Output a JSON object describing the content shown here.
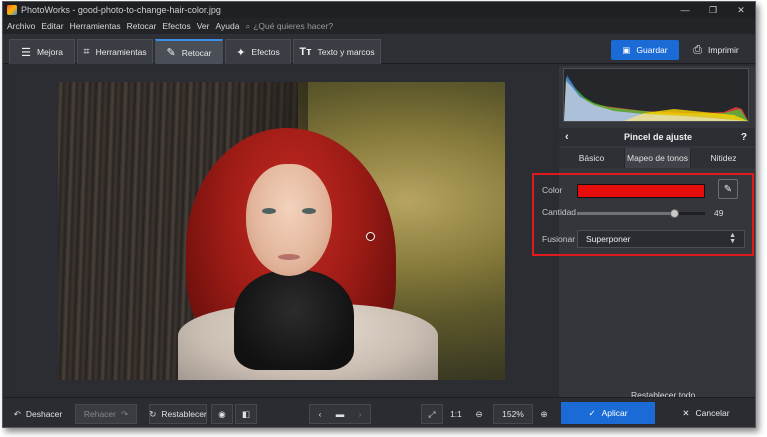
{
  "window": {
    "title": "PhotoWorks - good-photo-to-change-hair-color.jpg",
    "controls": [
      "—",
      "❐",
      "✕"
    ]
  },
  "menu": {
    "items": [
      "Archivo",
      "Editar",
      "Herramientas",
      "Retocar",
      "Efectos",
      "Ver",
      "Ayuda"
    ],
    "search_placeholder": "¿Qué quieres hacer?"
  },
  "tabs": [
    {
      "label": "Mejora",
      "icon": "sliders-icon"
    },
    {
      "label": "Herramientas",
      "icon": "crop-icon"
    },
    {
      "label": "Retocar",
      "icon": "brush-icon"
    },
    {
      "label": "Efectos",
      "icon": "wand-icon"
    },
    {
      "label": "Texto y marcos",
      "icon": "text-icon"
    }
  ],
  "actions": {
    "save": "Guardar",
    "print": "Imprimir"
  },
  "panel": {
    "title": "Pincel de ajuste",
    "subtabs": [
      "Básico",
      "Mapeo de tonos",
      "Nitidez"
    ],
    "color_label": "Color",
    "color_value": "#e60d0c",
    "amount_label": "Cantidad",
    "amount_value": "49",
    "amount_fraction": 0.76,
    "blend_label": "Fusionar",
    "blend_value": "Superponer",
    "reset": "Restablecer todo"
  },
  "bottom": {
    "undo": "Deshacer",
    "redo": "Rehacer",
    "restore": "Restablecer",
    "ratio": "1:1",
    "zoom": "152%",
    "apply": "Aplicar",
    "cancel": "Cancelar"
  },
  "colors": {
    "accent": "#1a6bd6",
    "highlight_box": "#e0191c"
  }
}
